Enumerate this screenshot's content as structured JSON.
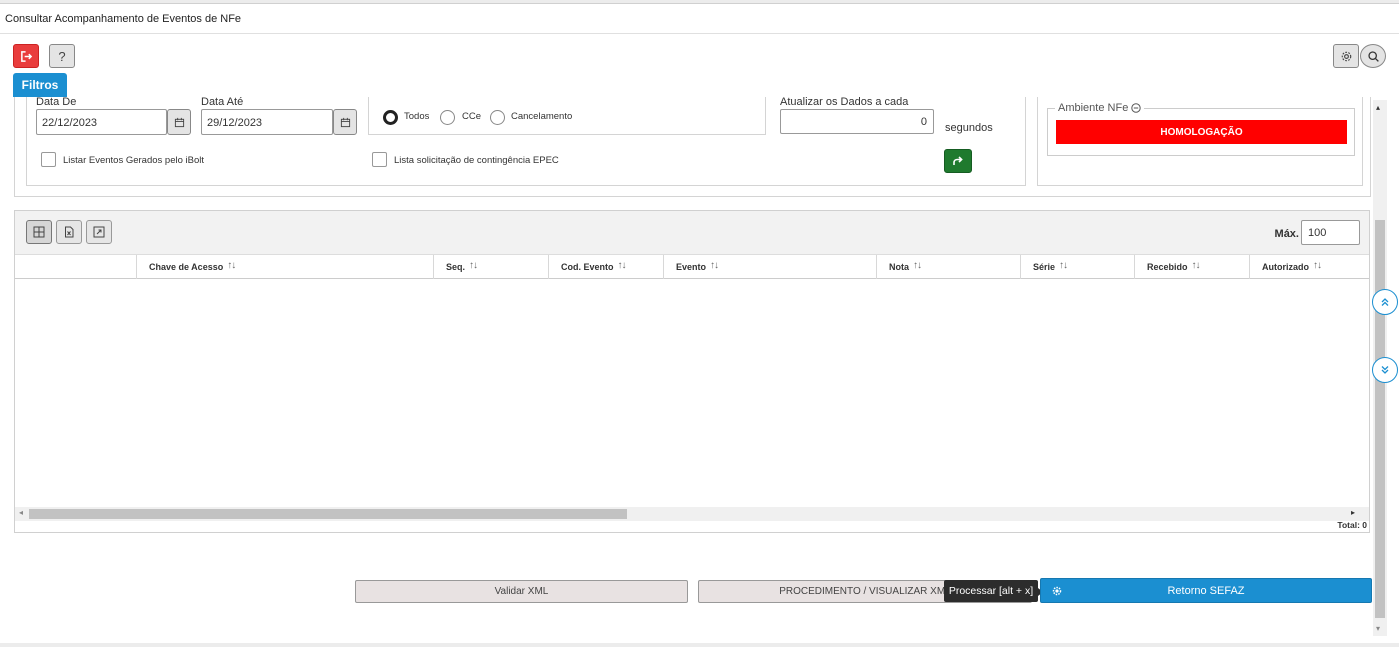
{
  "window": {
    "title": "Consultar Acompanhamento de Eventos de NFe"
  },
  "toolbar": {
    "help_label": "?"
  },
  "filters": {
    "tab_label": "Filtros",
    "date_from_label": "Data De",
    "date_from_value": "22/12/2023",
    "date_to_label": "Data Até",
    "date_to_value": "29/12/2023",
    "radios": [
      {
        "label": "Todos",
        "checked": true
      },
      {
        "label": "CCe",
        "checked": false
      },
      {
        "label": "Cancelamento",
        "checked": false
      }
    ],
    "refresh_label": "Atualizar os Dados a cada",
    "refresh_value": "0",
    "refresh_unit": "segundos",
    "check_ibolt_label": "Listar Eventos Gerados pelo iBolt",
    "check_epec_label": "Lista solicitação de contingência EPEC"
  },
  "ambiente": {
    "legend": "Ambiente NFe",
    "value": "HOMOLOGAÇÃO",
    "color": "#ff0000"
  },
  "grid": {
    "max_label": "Máx.",
    "max_value": "100",
    "columns": [
      "",
      "Chave de Acesso",
      "Seq.",
      "Cod. Evento",
      "Evento",
      "Nota",
      "Série",
      "Recebido",
      "Autorizado"
    ],
    "total_label": "Total: 0"
  },
  "actions": {
    "validar_label": "Validar XML",
    "procedimento_label": "PROCEDIMENTO / VISUALIZAR XML",
    "tooltip_label": "Processar [alt + x]",
    "retorno_label": "Retorno SEFAZ"
  },
  "colors": {
    "accent": "#1b8fd1",
    "exit": "#e93d3d",
    "go": "#1f7a2e"
  }
}
